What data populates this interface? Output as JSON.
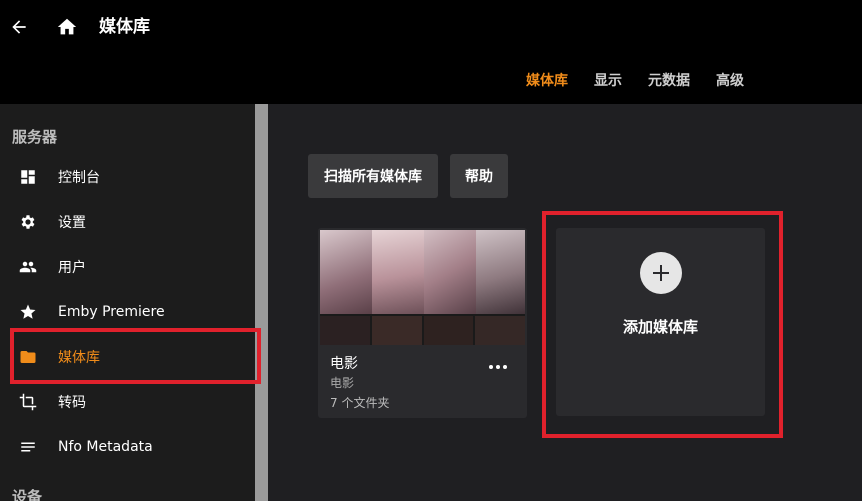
{
  "header": {
    "title": "媒体库",
    "tabs": [
      {
        "label": "媒体库",
        "active": true
      },
      {
        "label": "显示"
      },
      {
        "label": "元数据"
      },
      {
        "label": "高级"
      }
    ]
  },
  "sidebar": {
    "section_server": "服务器",
    "items": [
      {
        "label": "控制台",
        "icon": "dashboard-icon"
      },
      {
        "label": "设置",
        "icon": "gear-icon"
      },
      {
        "label": "用户",
        "icon": "users-icon"
      },
      {
        "label": "Emby Premiere",
        "icon": "star-icon"
      },
      {
        "label": "媒体库",
        "icon": "folder-icon",
        "active": true
      },
      {
        "label": "转码",
        "icon": "crop-icon"
      },
      {
        "label": "Nfo Metadata",
        "icon": "lines-icon"
      }
    ],
    "section_devices": "设备"
  },
  "main": {
    "scan_all_button": "扫描所有媒体库",
    "help_button": "帮助",
    "library_card": {
      "title": "电影",
      "type": "电影",
      "folder_count": "7 个文件夹"
    },
    "add_library_label": "添加媒体库"
  },
  "colors": {
    "accent": "#f08c1a",
    "highlight": "#e0212c"
  }
}
